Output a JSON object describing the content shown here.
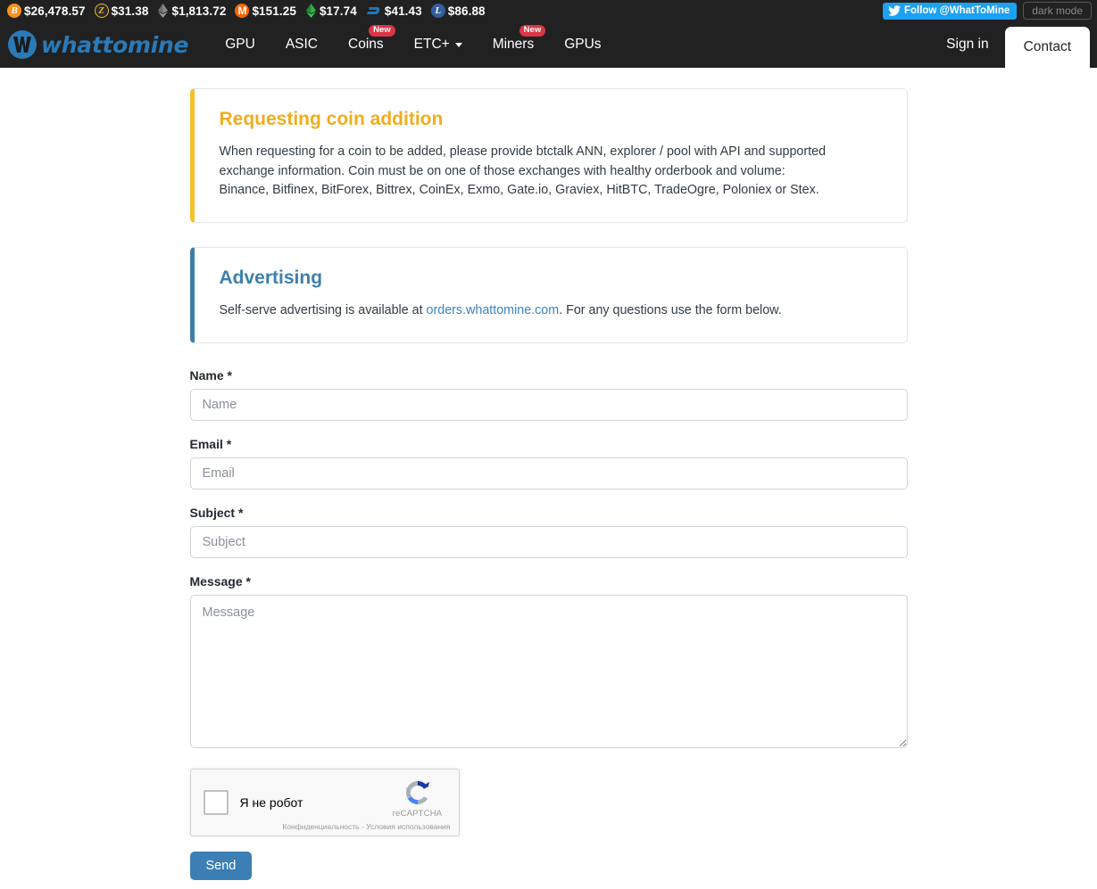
{
  "ticker": {
    "items": [
      {
        "icon": "bitcoin-icon",
        "symbol": "B",
        "price": "$26,478.57"
      },
      {
        "icon": "zcash-icon",
        "symbol": "Z",
        "price": "$31.38"
      },
      {
        "icon": "ethereum-icon",
        "symbol": "",
        "price": "$1,813.72"
      },
      {
        "icon": "monero-icon",
        "symbol": "M",
        "price": "$151.25"
      },
      {
        "icon": "ethereum-classic-icon",
        "symbol": "",
        "price": "$17.74"
      },
      {
        "icon": "dash-icon",
        "symbol": "D",
        "price": "$41.43"
      },
      {
        "icon": "litecoin-icon",
        "symbol": "L",
        "price": "$86.88"
      }
    ],
    "twitter_follow_label": "Follow @WhatToMine",
    "dark_mode_label": "dark mode"
  },
  "navbar": {
    "brand_text": "whattomine",
    "brand_mark_letter": "W",
    "links": [
      {
        "label": "GPU",
        "badge": "",
        "caret": false
      },
      {
        "label": "ASIC",
        "badge": "",
        "caret": false
      },
      {
        "label": "Coins",
        "badge": "New",
        "caret": false
      },
      {
        "label": "ETC+",
        "badge": "",
        "caret": true
      },
      {
        "label": "Miners",
        "badge": "New",
        "caret": false
      },
      {
        "label": "GPUs",
        "badge": "",
        "caret": false
      }
    ],
    "sign_in_label": "Sign in",
    "active_tab_label": "Contact"
  },
  "alerts": {
    "coin_addition": {
      "title": "Requesting coin addition",
      "line1": "When requesting for a coin to be added, please provide btctalk ANN, explorer / pool with API and supported exchange information. Coin must be on one of those exchanges with healthy orderbook and volume:",
      "line2": "Binance, Bitfinex, BitForex, Bittrex, CoinEx, Exmo, Gate.io, Graviex, HitBTC, TradeOgre, Poloniex or Stex."
    },
    "advertising": {
      "title": "Advertising",
      "text_before": "Self-serve advertising is available at ",
      "link": "orders.whattomine.com",
      "text_after": ". For any questions use the form below."
    }
  },
  "form": {
    "name": {
      "label": "Name *",
      "placeholder": "Name",
      "value": ""
    },
    "email": {
      "label": "Email *",
      "placeholder": "Email",
      "value": ""
    },
    "subject": {
      "label": "Subject *",
      "placeholder": "Subject",
      "value": ""
    },
    "message": {
      "label": "Message *",
      "placeholder": "Message",
      "value": ""
    },
    "submit_label": "Send"
  },
  "recaptcha": {
    "checkbox_label": "Я не робот",
    "brand_name": "reCAPTCHA",
    "privacy_label": "Конфиденциальность",
    "separator": " - ",
    "terms_label": "Условия использования"
  },
  "colors": {
    "navbar_bg": "#212121",
    "brand_blue": "#2a7ab8",
    "accent_warning": "#f5c22b",
    "accent_info": "#3d7eaa",
    "badge_red": "#dc3545",
    "twitter_blue": "#1da1f2",
    "button_blue": "#3b7fb5",
    "link_blue": "#3b84c4"
  }
}
